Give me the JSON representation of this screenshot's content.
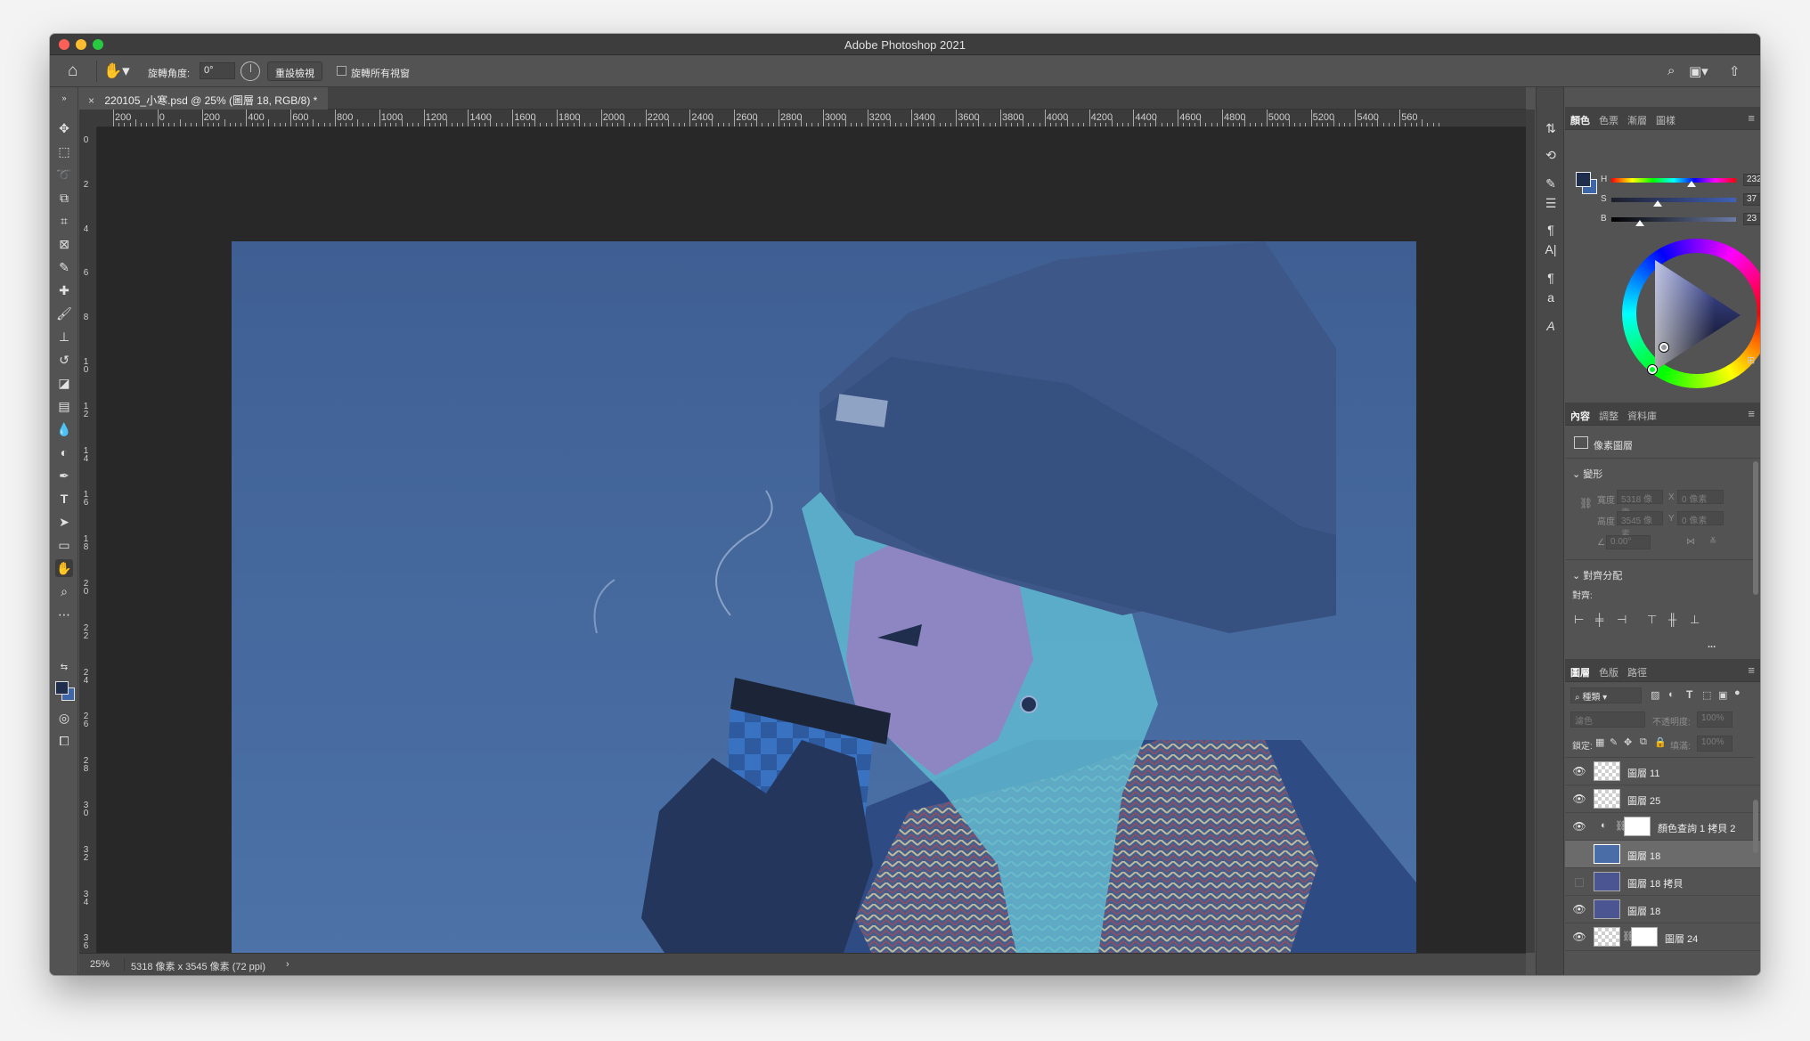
{
  "window": {
    "title": "Adobe Photoshop 2021"
  },
  "options_bar": {
    "rotate_angle_label": "旋轉角度:",
    "rotate_angle_value": "0°",
    "reset_view_label": "重設檢視",
    "rotate_all_windows_label": "旋轉所有視窗"
  },
  "document": {
    "tab_title": "220105_小寒.psd @ 25% (圖層 18, RGB/8) *",
    "zoom": "25%",
    "size_info": "5318 像素 x 3545 像素 (72 ppi)"
  },
  "ruler_top": [
    "200",
    "0",
    "200",
    "400",
    "600",
    "800",
    "1000",
    "1200",
    "1400",
    "1600",
    "1800",
    "2000",
    "2200",
    "2400",
    "2600",
    "2800",
    "3000",
    "3200",
    "3400",
    "3600",
    "3800",
    "4000",
    "4200",
    "4400",
    "4600",
    "4800",
    "5000",
    "5200",
    "5400",
    "560"
  ],
  "ruler_left": [
    "0",
    "2",
    "4",
    "6",
    "8",
    "10",
    "12",
    "14",
    "16",
    "18",
    "20",
    "22",
    "24",
    "26",
    "28",
    "30",
    "32",
    "34",
    "36"
  ],
  "color_panel": {
    "tabs": [
      "顏色",
      "色票",
      "漸層",
      "圖樣"
    ],
    "h_label": "H",
    "h_value": "232",
    "h_unit": "°",
    "s_label": "S",
    "s_value": "37",
    "s_unit": "%",
    "b_label": "B",
    "b_value": "23",
    "b_unit": "%",
    "h_fraction": 0.644,
    "s_fraction": 0.37,
    "b_fraction": 0.23,
    "foreground_color": "#1f2e4c",
    "background_color": "#3f67a8"
  },
  "properties_panel": {
    "tabs": [
      "內容",
      "調整",
      "資料庫"
    ],
    "layer_type": "像素圖層",
    "transform_section": "變形",
    "width_label": "寬度",
    "width_value": "5318 像素",
    "height_label": "高度",
    "height_value": "3545 像素",
    "x_label": "X",
    "x_value": "0 像素",
    "y_label": "Y",
    "y_value": "0 像素",
    "angle_value": "0.00°",
    "align_section": "對齊分配",
    "align_label": "對齊:",
    "more": "..."
  },
  "layers_panel": {
    "tabs": [
      "圖層",
      "色版",
      "路徑"
    ],
    "filter_kind": "種類",
    "blend_mode": "濾色",
    "opacity_label": "不透明度:",
    "opacity_value": "100%",
    "lock_label": "鎖定:",
    "fill_label": "填滿:",
    "fill_value": "100%",
    "layers": [
      {
        "name": "圖層 11",
        "visible": true,
        "thumb": "checker"
      },
      {
        "name": "圖層 25",
        "visible": true,
        "thumb": "checker"
      },
      {
        "name": "顏色查詢 1 拷貝 2",
        "visible": true,
        "thumb": "adjustment"
      },
      {
        "name": "圖層 18",
        "visible": false,
        "thumb": "#4a6da8",
        "selected": true
      },
      {
        "name": "圖層 18 拷貝",
        "visible": false,
        "thumb": "#4a5592"
      },
      {
        "name": "圖層 18",
        "visible": true,
        "thumb": "#4a5592"
      },
      {
        "name": "圖層 24",
        "visible": true,
        "thumb": "checker-mask"
      }
    ]
  },
  "artwork_colors": {
    "background": "#48699c",
    "beanie": "#3d5888",
    "coat": "#2f4b84",
    "hair": "#5fb8d0",
    "skin": "#8e86c2",
    "glove": "#25365c",
    "cup_check": "#3466b0",
    "cup_red": "#6b3a5c",
    "scarf": "#3b5482"
  }
}
